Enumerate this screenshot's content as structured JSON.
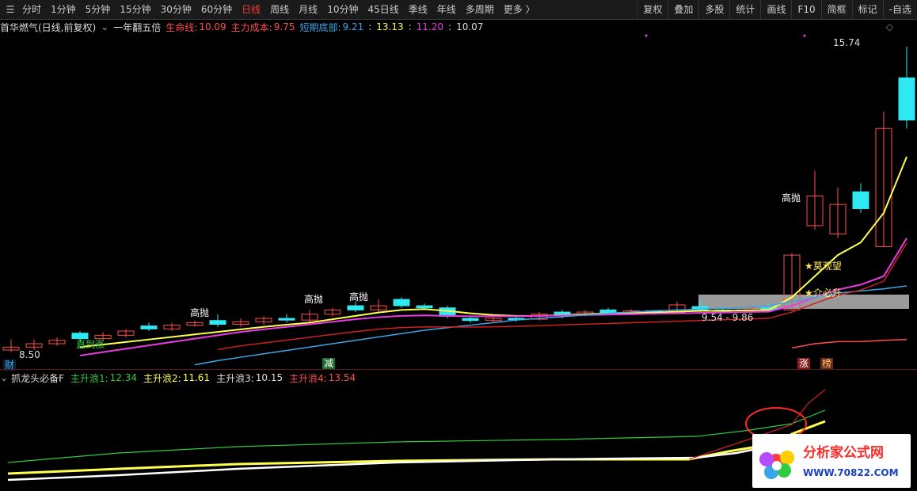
{
  "toolbar": {
    "periods": [
      "分时",
      "1分钟",
      "5分钟",
      "15分钟",
      "30分钟",
      "60分钟",
      "日线",
      "周线",
      "月线",
      "10分钟",
      "45日线",
      "季线",
      "年线",
      "多周期",
      "更多 〉"
    ],
    "active_period": "日线",
    "tools": [
      "复权",
      "叠加",
      "多股",
      "统计",
      "画线",
      "F10",
      "简框",
      "标记",
      "-自选"
    ]
  },
  "infobar": {
    "stock": "首华燃气(日线,前复权)",
    "indicator": "一年翻五倍",
    "life_line_label": "生命线:",
    "life_line": "10.09",
    "main_cost_label": "主力成本:",
    "main_cost": "9.75",
    "short_bottom_label": "短期底部:",
    "short_bottom": "9.21",
    "v1": "13.13",
    "v2": "11.20",
    "v3": "10.07",
    "sep": ":"
  },
  "main_chart": {
    "high_price": "15.74",
    "low_price": "8.50",
    "range_label": "9.54 - 9.86",
    "labels": {
      "sell1": "高抛",
      "sell2": "高抛",
      "sell3": "高抛",
      "sell4": "高抛",
      "buy": "直到涨",
      "watch": "★莫观望",
      "rise": "★介必升",
      "cai": "财",
      "jian": "减",
      "zhang": "涨",
      "bang": "榜"
    }
  },
  "sub_chart": {
    "name": "抓龙头必备F",
    "w1_label": "主升浪1:",
    "w1": "12.34",
    "w2_label": "主升浪2:",
    "w2": "11.61",
    "w3_label": "主升浪3:",
    "w3": "10.15",
    "w4_label": "主升浪4:",
    "w4": "13.54"
  },
  "watermark": {
    "title": "分析家公式网",
    "url": "WWW.70822.COM"
  },
  "colors": {
    "up": "#ff4d4d",
    "down": "#2ee8f2",
    "life": "#ffff4d",
    "cost": "#e83ce0",
    "bottom": "#3aa6e8",
    "green": "#2ecc40"
  },
  "chart_data": {
    "type": "candlestick",
    "y_range_main": [
      8.4,
      16.0
    ],
    "candles": [
      {
        "o": 8.55,
        "c": 8.62,
        "h": 8.8,
        "l": 8.5
      },
      {
        "o": 8.62,
        "c": 8.7,
        "h": 8.8,
        "l": 8.55
      },
      {
        "o": 8.7,
        "c": 8.78,
        "h": 8.85,
        "l": 8.65
      },
      {
        "o": 8.95,
        "c": 8.82,
        "h": 9.0,
        "l": 8.75
      },
      {
        "o": 8.82,
        "c": 8.9,
        "h": 8.98,
        "l": 8.78
      },
      {
        "o": 8.9,
        "c": 9.0,
        "h": 9.05,
        "l": 8.85
      },
      {
        "o": 9.12,
        "c": 9.05,
        "h": 9.2,
        "l": 9.0
      },
      {
        "o": 9.05,
        "c": 9.14,
        "h": 9.2,
        "l": 9.0
      },
      {
        "o": 9.14,
        "c": 9.2,
        "h": 9.25,
        "l": 9.1
      },
      {
        "o": 9.25,
        "c": 9.16,
        "h": 9.4,
        "l": 9.1
      },
      {
        "o": 9.16,
        "c": 9.22,
        "h": 9.3,
        "l": 9.1
      },
      {
        "o": 9.22,
        "c": 9.3,
        "h": 9.35,
        "l": 9.15
      },
      {
        "o": 9.3,
        "c": 9.26,
        "h": 9.4,
        "l": 9.2
      },
      {
        "o": 9.26,
        "c": 9.4,
        "h": 9.5,
        "l": 9.2
      },
      {
        "o": 9.4,
        "c": 9.5,
        "h": 9.55,
        "l": 9.35
      },
      {
        "o": 9.6,
        "c": 9.5,
        "h": 9.7,
        "l": 9.45
      },
      {
        "o": 9.5,
        "c": 9.6,
        "h": 9.75,
        "l": 9.45
      },
      {
        "o": 9.75,
        "c": 9.6,
        "h": 9.8,
        "l": 9.55
      },
      {
        "o": 9.6,
        "c": 9.55,
        "h": 9.65,
        "l": 9.5
      },
      {
        "o": 9.55,
        "c": 9.35,
        "h": 9.6,
        "l": 9.3
      },
      {
        "o": 9.3,
        "c": 9.25,
        "h": 9.35,
        "l": 9.2
      },
      {
        "o": 9.25,
        "c": 9.3,
        "h": 9.4,
        "l": 9.2
      },
      {
        "o": 9.3,
        "c": 9.28,
        "h": 9.35,
        "l": 9.22
      },
      {
        "o": 9.28,
        "c": 9.4,
        "h": 9.45,
        "l": 9.25
      },
      {
        "o": 9.45,
        "c": 9.38,
        "h": 9.5,
        "l": 9.3
      },
      {
        "o": 9.38,
        "c": 9.45,
        "h": 9.5,
        "l": 9.35
      },
      {
        "o": 9.5,
        "c": 9.42,
        "h": 9.55,
        "l": 9.38
      },
      {
        "o": 9.42,
        "c": 9.48,
        "h": 9.52,
        "l": 9.4
      },
      {
        "o": 9.48,
        "c": 9.42,
        "h": 9.5,
        "l": 9.38
      },
      {
        "o": 9.45,
        "c": 9.62,
        "h": 9.7,
        "l": 9.4
      },
      {
        "o": 9.58,
        "c": 9.5,
        "h": 9.75,
        "l": 9.45
      },
      {
        "o": 9.5,
        "c": 9.48,
        "h": 9.55,
        "l": 9.45
      },
      {
        "o": 9.48,
        "c": 9.55,
        "h": 9.6,
        "l": 9.45
      },
      {
        "o": 9.55,
        "c": 9.5,
        "h": 9.65,
        "l": 9.48
      },
      {
        "o": 9.5,
        "c": 10.8,
        "h": 10.85,
        "l": 9.5
      },
      {
        "o": 11.5,
        "c": 12.2,
        "h": 12.8,
        "l": 11.4
      },
      {
        "o": 11.3,
        "c": 12.0,
        "h": 12.4,
        "l": 11.2
      },
      {
        "o": 12.3,
        "c": 11.9,
        "h": 12.5,
        "l": 11.8
      },
      {
        "o": 11.0,
        "c": 13.8,
        "h": 14.2,
        "l": 11.0
      },
      {
        "o": 15.0,
        "c": 14.0,
        "h": 15.74,
        "l": 13.8
      }
    ],
    "series": [
      {
        "name": "生命线",
        "values": [
          null,
          null,
          null,
          8.62,
          8.68,
          8.74,
          8.8,
          8.86,
          8.92,
          8.98,
          9.04,
          9.1,
          9.15,
          9.2,
          9.28,
          9.36,
          9.44,
          9.5,
          9.52,
          9.48,
          9.42,
          9.38,
          9.36,
          9.36,
          9.38,
          9.4,
          9.42,
          9.43,
          9.44,
          9.46,
          9.48,
          9.48,
          9.49,
          9.5,
          9.8,
          10.3,
          10.8,
          11.1,
          11.8,
          13.13
        ]
      },
      {
        "name": "主力成本",
        "values": [
          null,
          null,
          null,
          8.42,
          8.5,
          8.58,
          8.66,
          8.74,
          8.82,
          8.9,
          8.98,
          9.04,
          9.1,
          9.16,
          9.22,
          9.28,
          9.33,
          9.36,
          9.37,
          9.36,
          9.35,
          9.35,
          9.35,
          9.36,
          9.37,
          9.38,
          9.39,
          9.4,
          9.41,
          9.42,
          9.43,
          9.44,
          9.45,
          9.46,
          9.6,
          9.8,
          9.98,
          10.1,
          10.3,
          11.2
        ]
      },
      {
        "name": "短期底部",
        "values": [
          null,
          null,
          null,
          null,
          null,
          null,
          null,
          null,
          8.2,
          8.3,
          8.38,
          8.46,
          8.54,
          8.62,
          8.7,
          8.78,
          8.86,
          8.94,
          9.02,
          9.08,
          9.14,
          9.2,
          9.26,
          9.3,
          9.34,
          9.38,
          9.42,
          9.45,
          9.48,
          9.5,
          9.52,
          9.54,
          9.56,
          9.6,
          9.7,
          9.8,
          9.9,
          9.95,
          10.0,
          10.07
        ]
      },
      {
        "name": "主升浪3",
        "values": [
          null,
          null,
          null,
          null,
          null,
          null,
          null,
          null,
          null,
          null,
          null,
          null,
          null,
          null,
          null,
          null,
          null,
          null,
          null,
          null,
          null,
          null,
          null,
          null,
          null,
          null,
          null,
          null,
          null,
          null,
          null,
          null,
          null,
          null,
          8.6,
          8.7,
          8.75,
          8.75,
          8.78,
          8.8
        ]
      }
    ]
  }
}
